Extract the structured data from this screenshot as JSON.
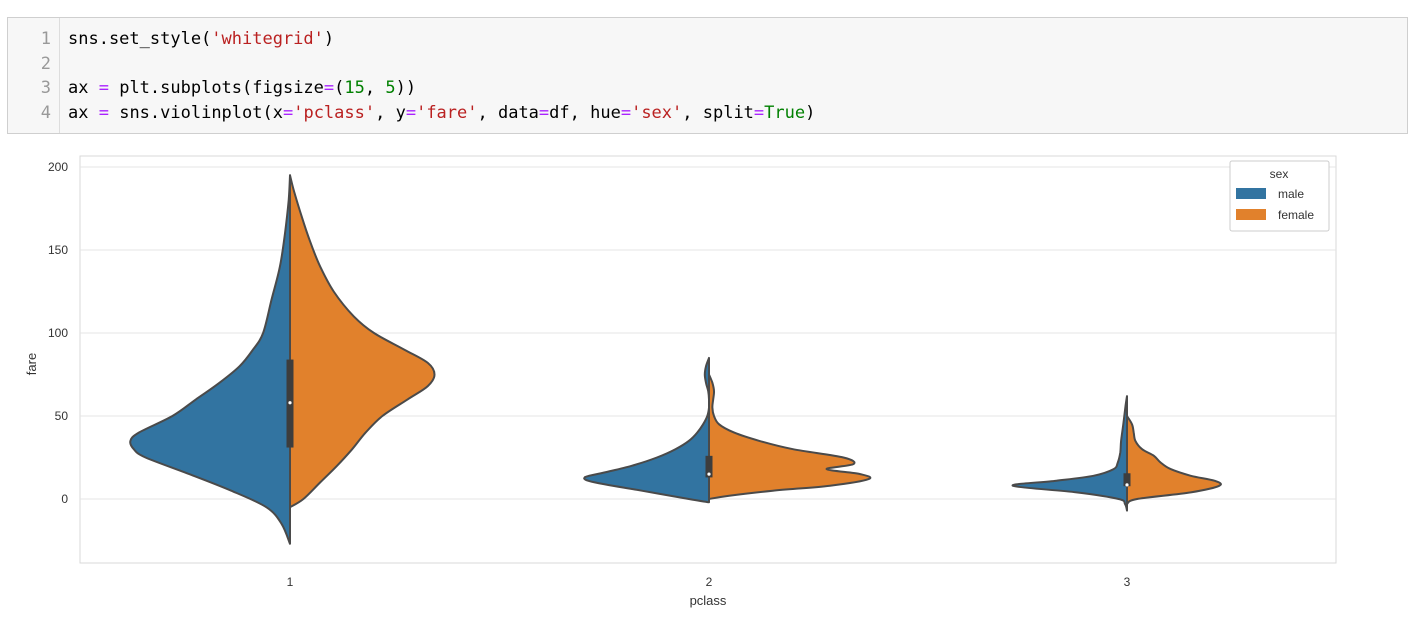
{
  "cell": {
    "line_numbers": [
      "1",
      "2",
      "3",
      "4"
    ],
    "lines": [
      [
        {
          "t": "sns.set_style(",
          "c": "plain"
        },
        {
          "t": "'whitegrid'",
          "c": "str"
        },
        {
          "t": ")",
          "c": "plain"
        }
      ],
      [],
      [
        {
          "t": "ax ",
          "c": "plain"
        },
        {
          "t": "=",
          "c": "op"
        },
        {
          "t": " plt.subplots(figsize",
          "c": "plain"
        },
        {
          "t": "=",
          "c": "op"
        },
        {
          "t": "(",
          "c": "plain"
        },
        {
          "t": "15",
          "c": "num"
        },
        {
          "t": ", ",
          "c": "plain"
        },
        {
          "t": "5",
          "c": "num"
        },
        {
          "t": "))",
          "c": "plain"
        }
      ],
      [
        {
          "t": "ax ",
          "c": "plain"
        },
        {
          "t": "=",
          "c": "op"
        },
        {
          "t": " sns.violinplot(x",
          "c": "plain"
        },
        {
          "t": "=",
          "c": "op"
        },
        {
          "t": "'pclass'",
          "c": "str"
        },
        {
          "t": ", y",
          "c": "plain"
        },
        {
          "t": "=",
          "c": "op"
        },
        {
          "t": "'fare'",
          "c": "str"
        },
        {
          "t": ", data",
          "c": "plain"
        },
        {
          "t": "=",
          "c": "op"
        },
        {
          "t": "df, hue",
          "c": "plain"
        },
        {
          "t": "=",
          "c": "op"
        },
        {
          "t": "'sex'",
          "c": "str"
        },
        {
          "t": ", split",
          "c": "plain"
        },
        {
          "t": "=",
          "c": "op"
        },
        {
          "t": "True",
          "c": "kw"
        },
        {
          "t": ")",
          "c": "plain"
        }
      ]
    ]
  },
  "colors": {
    "male": "#3274a1",
    "female": "#e1812c",
    "outline": "#4a4a4a",
    "grid": "#e5e5e5",
    "frame": "#d9d9d9",
    "tick_text": "#333333"
  },
  "chart_data": {
    "type": "violin",
    "split": true,
    "xlabel": "pclass",
    "ylabel": "fare",
    "categories": [
      "1",
      "2",
      "3"
    ],
    "ylim": [
      -40,
      205
    ],
    "yticks": [
      0,
      50,
      100,
      150,
      200
    ],
    "grid": true,
    "legend": {
      "title": "sex",
      "placement": "top-right",
      "entries": [
        "male",
        "female"
      ]
    },
    "series": [
      {
        "name": "male",
        "violins": [
          {
            "category": "1",
            "profile": [
              [
                -27,
                0
              ],
              [
                -15,
                0.05
              ],
              [
                -5,
                0.14
              ],
              [
                5,
                0.35
              ],
              [
                15,
                0.6
              ],
              [
                25,
                0.86
              ],
              [
                30,
                0.93
              ],
              [
                35,
                0.95
              ],
              [
                40,
                0.9
              ],
              [
                50,
                0.7
              ],
              [
                60,
                0.56
              ],
              [
                70,
                0.42
              ],
              [
                80,
                0.3
              ],
              [
                90,
                0.22
              ],
              [
                100,
                0.16
              ],
              [
                120,
                0.11
              ],
              [
                140,
                0.06
              ],
              [
                160,
                0.03
              ],
              [
                180,
                0.008
              ],
              [
                195,
                0
              ]
            ]
          },
          {
            "category": "2",
            "profile": [
              [
                -2,
                0
              ],
              [
                0,
                0.12
              ],
              [
                5,
                0.4
              ],
              [
                10,
                0.68
              ],
              [
                13,
                0.74
              ],
              [
                16,
                0.62
              ],
              [
                20,
                0.46
              ],
              [
                25,
                0.31
              ],
              [
                30,
                0.2
              ],
              [
                35,
                0.12
              ],
              [
                40,
                0.07
              ],
              [
                45,
                0.035
              ],
              [
                50,
                0.01
              ],
              [
                55,
                0
              ],
              [
                60,
                0
              ],
              [
                65,
                0.005
              ],
              [
                70,
                0.018
              ],
              [
                75,
                0.025
              ],
              [
                80,
                0.018
              ],
              [
                85,
                0
              ]
            ]
          },
          {
            "category": "3",
            "profile": [
              [
                -7,
                0
              ],
              [
                -3,
                0.012
              ],
              [
                0,
                0.05
              ],
              [
                4,
                0.3
              ],
              [
                8,
                0.68
              ],
              [
                11,
                0.42
              ],
              [
                14,
                0.2
              ],
              [
                18,
                0.08
              ],
              [
                22,
                0.055
              ],
              [
                28,
                0.04
              ],
              [
                35,
                0.035
              ],
              [
                45,
                0.022
              ],
              [
                55,
                0.01
              ],
              [
                62,
                0
              ]
            ]
          }
        ]
      },
      {
        "name": "female",
        "violins": [
          {
            "category": "1",
            "profile": [
              [
                -5,
                0
              ],
              [
                0,
                0.08
              ],
              [
                10,
                0.18
              ],
              [
                20,
                0.28
              ],
              [
                30,
                0.37
              ],
              [
                40,
                0.45
              ],
              [
                50,
                0.55
              ],
              [
                60,
                0.7
              ],
              [
                68,
                0.82
              ],
              [
                75,
                0.86
              ],
              [
                82,
                0.82
              ],
              [
                90,
                0.68
              ],
              [
                100,
                0.5
              ],
              [
                110,
                0.38
              ],
              [
                125,
                0.26
              ],
              [
                140,
                0.18
              ],
              [
                155,
                0.12
              ],
              [
                170,
                0.07
              ],
              [
                185,
                0.025
              ],
              [
                195,
                0
              ]
            ]
          },
          {
            "category": "2",
            "profile": [
              [
                0,
                0
              ],
              [
                2,
                0.12
              ],
              [
                5,
                0.38
              ],
              [
                8,
                0.72
              ],
              [
                12,
                0.95
              ],
              [
                15,
                0.9
              ],
              [
                18,
                0.7
              ],
              [
                21,
                0.86
              ],
              [
                25,
                0.8
              ],
              [
                30,
                0.5
              ],
              [
                35,
                0.3
              ],
              [
                40,
                0.15
              ],
              [
                45,
                0.06
              ],
              [
                50,
                0.03
              ],
              [
                55,
                0.02
              ],
              [
                60,
                0.025
              ],
              [
                65,
                0.03
              ],
              [
                70,
                0.02
              ],
              [
                75,
                0
              ]
            ]
          },
          {
            "category": "3",
            "profile": [
              [
                -3,
                0
              ],
              [
                0,
                0.06
              ],
              [
                4,
                0.38
              ],
              [
                8,
                0.55
              ],
              [
                11,
                0.52
              ],
              [
                14,
                0.38
              ],
              [
                18,
                0.26
              ],
              [
                22,
                0.2
              ],
              [
                26,
                0.16
              ],
              [
                30,
                0.09
              ],
              [
                35,
                0.05
              ],
              [
                40,
                0.04
              ],
              [
                45,
                0.03
              ],
              [
                50,
                0
              ]
            ]
          }
        ]
      }
    ],
    "boxes": [
      {
        "category": "1",
        "q1": 31,
        "median": 58,
        "q3": 84
      },
      {
        "category": "2",
        "q1": 13,
        "median": 15,
        "q3": 26
      },
      {
        "category": "3",
        "q1": 7.7,
        "median": 8.5,
        "q3": 15.5
      }
    ]
  }
}
